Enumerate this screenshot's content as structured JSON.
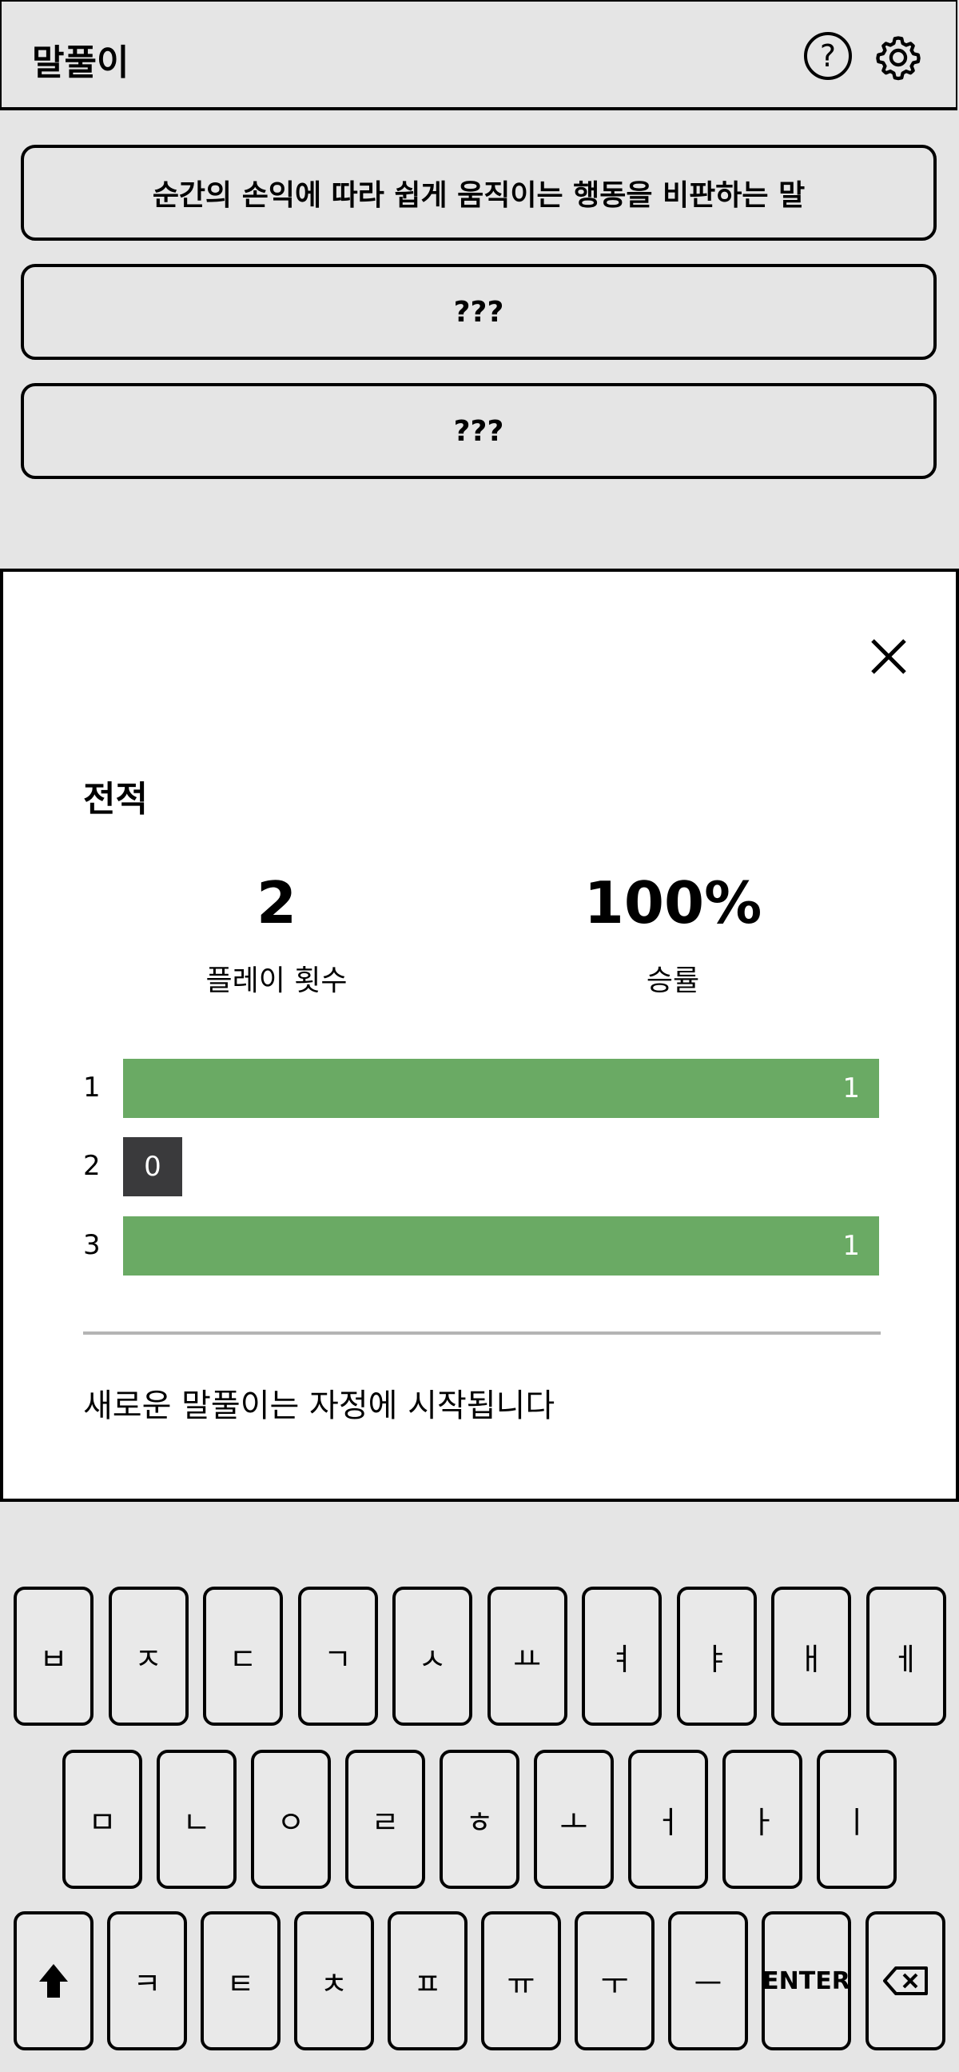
{
  "app": {
    "title": "말풀이"
  },
  "clues": [
    "순간의 손익에 따라 쉽게 움직이는 행동을 비판하는 말",
    "???",
    "???"
  ],
  "stats": {
    "title": "전적",
    "played": {
      "value": "2",
      "label": "플레이 횟수"
    },
    "win_rate": {
      "value": "100%",
      "label": "승률"
    },
    "distribution": [
      {
        "label": "1",
        "count": "1",
        "fraction": 1.0,
        "color": "#6aaa64"
      },
      {
        "label": "2",
        "count": "0",
        "fraction": 0.0,
        "color": "#3a3a3c"
      },
      {
        "label": "3",
        "count": "1",
        "fraction": 1.0,
        "color": "#6aaa64"
      }
    ],
    "next_puzzle_text": "새로운 말풀이는 자정에 시작됩니다"
  },
  "keyboard": {
    "row1": [
      "ㅂ",
      "ㅈ",
      "ㄷ",
      "ㄱ",
      "ㅅ",
      "ㅛ",
      "ㅕ",
      "ㅑ",
      "ㅐ",
      "ㅔ"
    ],
    "row2": [
      "ㅁ",
      "ㄴ",
      "ㅇ",
      "ㄹ",
      "ㅎ",
      "ㅗ",
      "ㅓ",
      "ㅏ",
      "ㅣ"
    ],
    "row3": [
      "ㅋ",
      "ㅌ",
      "ㅊ",
      "ㅍ",
      "ㅠ",
      "ㅜ",
      "ㅡ"
    ],
    "enter_label": "ENTER",
    "shift_icon": "shift-arrow-icon",
    "backspace_icon": "backspace-icon"
  },
  "colors": {
    "correct": "#6aaa64",
    "absent": "#3a3a3c",
    "background": "#e5e5e5"
  }
}
